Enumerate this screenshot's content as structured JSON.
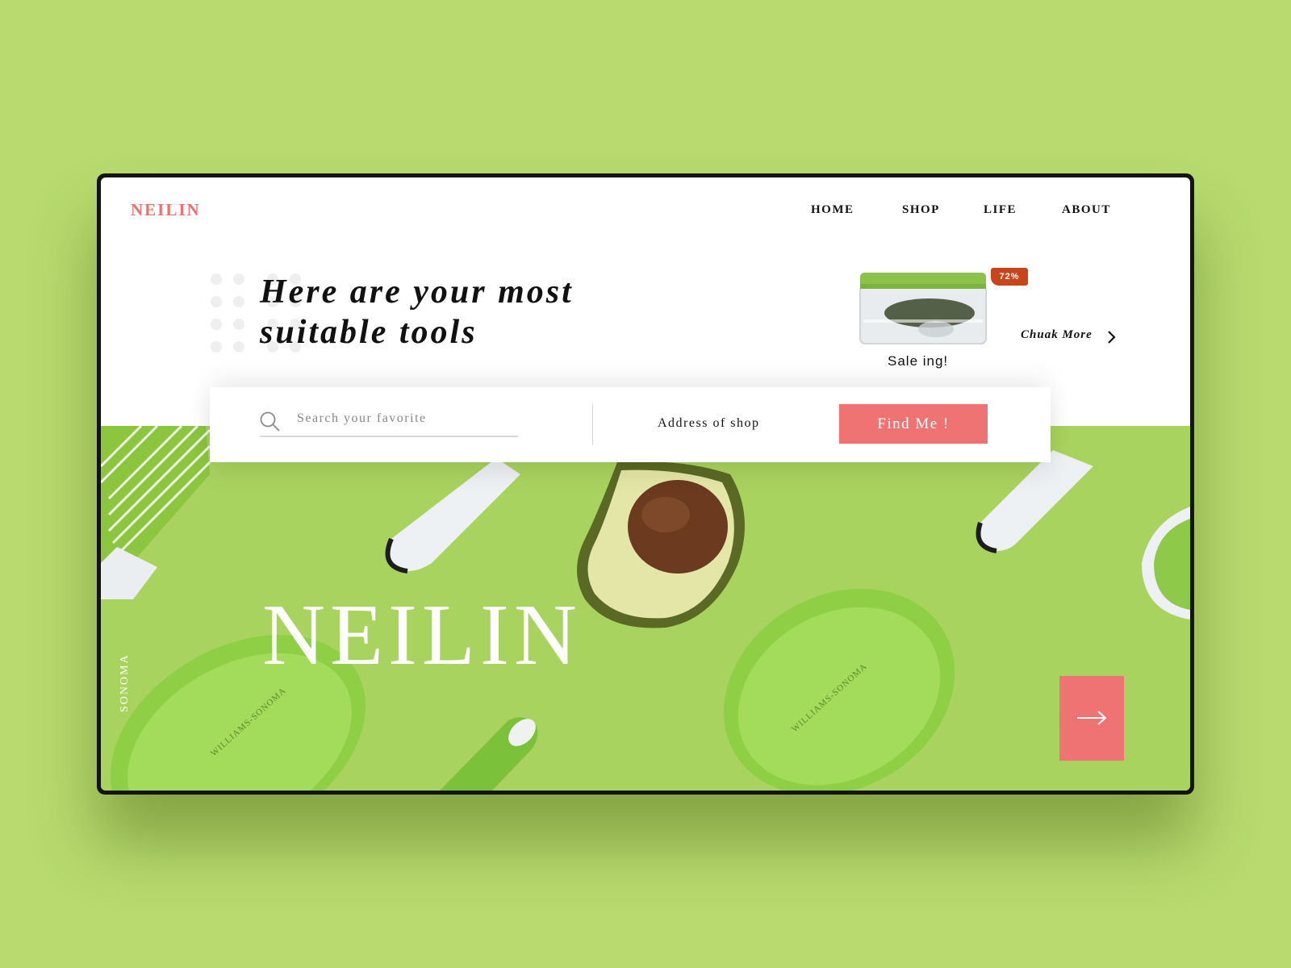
{
  "header": {
    "logo": "NEILIN",
    "nav": [
      "HOME",
      "SHOP",
      "LIFE",
      "ABOUT"
    ]
  },
  "hero": {
    "headline_line1": "Here are your most",
    "headline_line2": "suitable tools",
    "brand_big": "NEILIN",
    "side_text": "SONOMA",
    "product_print": "WILLIAMS-SONOMA",
    "next_icon": "arrow-right-icon"
  },
  "sale": {
    "badge": "72%",
    "label": "Sale ing!",
    "more": "Chuak More",
    "more_icon": "chevron-right-icon"
  },
  "search": {
    "icon": "search-icon",
    "placeholder": "Search your favorite",
    "address_label": "Address of  shop",
    "find_button": "Find Me !"
  },
  "colors": {
    "page_background": "#b8da6e",
    "accent": "#f07373",
    "logo": "#ef6f6f",
    "badge": "#c8441a",
    "hero_green": "#a9d35f"
  }
}
